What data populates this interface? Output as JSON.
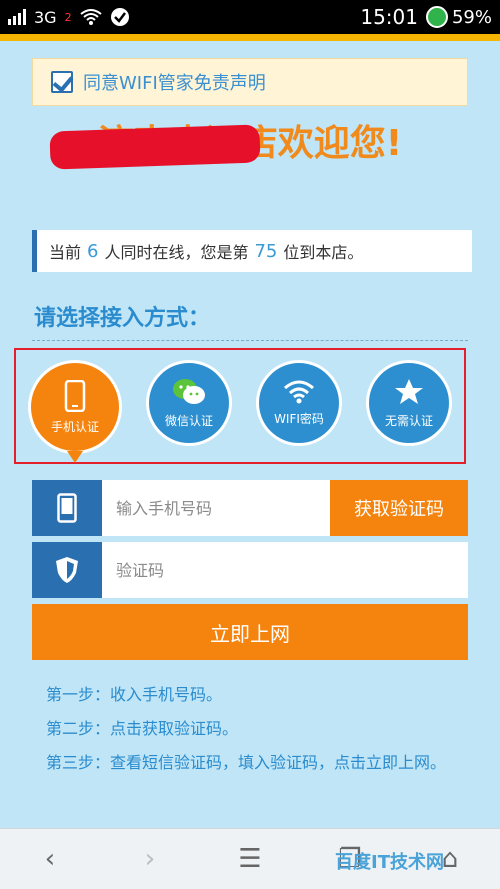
{
  "status_bar": {
    "network": "3G",
    "sim": "2",
    "time": "15:01",
    "battery": "59%"
  },
  "agreement": {
    "text": "同意WIFI管家免责声明",
    "checked": true
  },
  "welcome": {
    "text": "济南大酒店欢迎您!"
  },
  "online": {
    "prefix": "当前",
    "count": "6",
    "middle": "人同时在线，您是第",
    "rank": "75",
    "suffix": "位到本店。"
  },
  "section_title": "请选择接入方式：",
  "methods": [
    {
      "label": "手机认证",
      "icon": "phone-icon",
      "active": true
    },
    {
      "label": "微信认证",
      "icon": "wechat-icon",
      "active": false
    },
    {
      "label": "WIFI密码",
      "icon": "wifi-icon",
      "active": false
    },
    {
      "label": "无需认证",
      "icon": "star-icon",
      "active": false
    }
  ],
  "phone_input": {
    "placeholder": "输入手机号码",
    "value": ""
  },
  "get_code_label": "获取验证码",
  "code_input": {
    "placeholder": "验证码",
    "value": ""
  },
  "connect_label": "立即上网",
  "steps": [
    "第一步：收入手机号码。",
    "第二步：点击获取验证码。",
    "第三步：查看短信验证码，填入验证码，点击立即上网。"
  ],
  "watermark": "百度IT技术网",
  "colors": {
    "background": "#bfe5f6",
    "orange": "#f5840e",
    "blue": "#2a6fb0",
    "highlight_red": "#e21f2a"
  }
}
